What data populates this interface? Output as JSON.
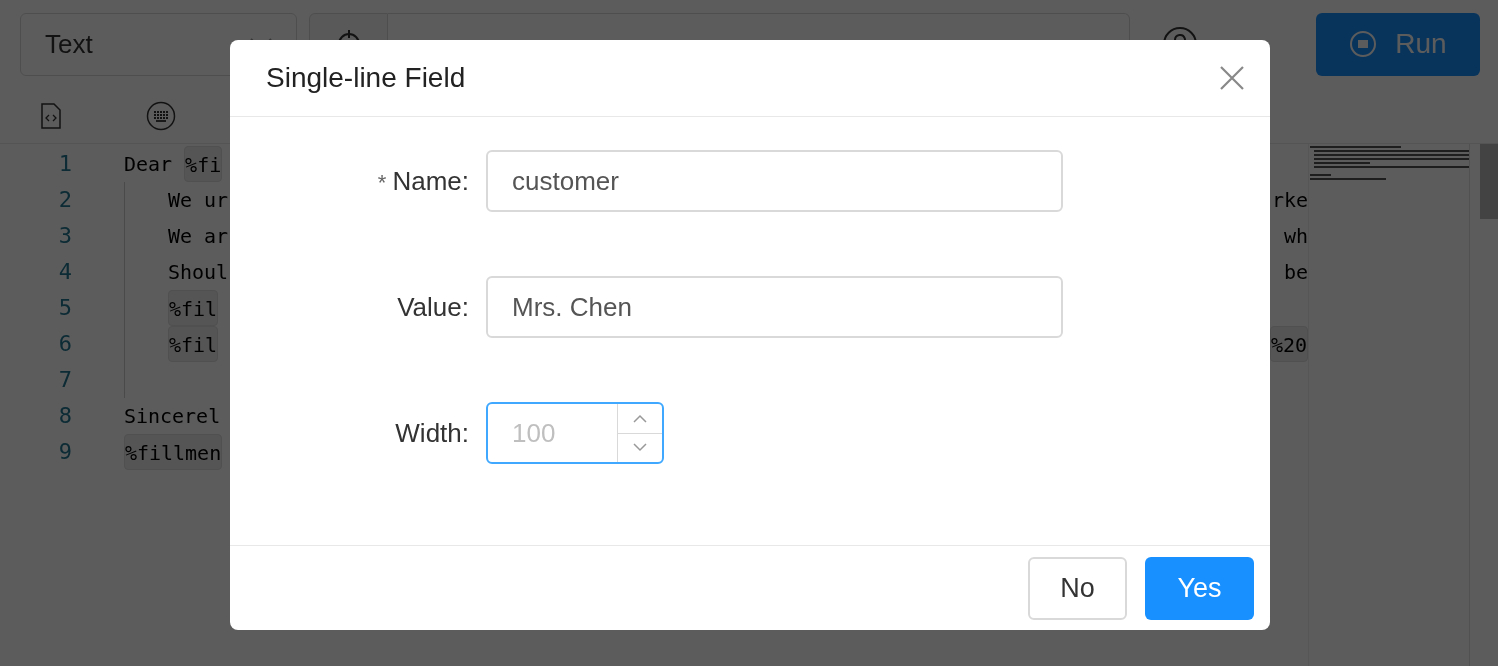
{
  "toolbar": {
    "mode_select": "Text",
    "run_button": "Run"
  },
  "editor": {
    "lines": [
      {
        "number": "1",
        "indented": false,
        "left": [
          {
            "kind": "plain",
            "text": "Dear "
          },
          {
            "kind": "chip",
            "text": "%fi"
          }
        ]
      },
      {
        "number": "2",
        "indented": true,
        "left": [
          {
            "kind": "plain",
            "text": "We ur"
          }
        ],
        "right": [
          {
            "kind": "plain",
            "text": "rke"
          }
        ]
      },
      {
        "number": "3",
        "indented": true,
        "left": [
          {
            "kind": "plain",
            "text": "We ar"
          }
        ],
        "right": [
          {
            "kind": "plain",
            "text": "wh"
          }
        ]
      },
      {
        "number": "4",
        "indented": true,
        "left": [
          {
            "kind": "plain",
            "text": "Shoul"
          }
        ],
        "right": [
          {
            "kind": "plain",
            "text": "be"
          }
        ]
      },
      {
        "number": "5",
        "indented": true,
        "left": [
          {
            "kind": "chip",
            "text": "%fil"
          }
        ]
      },
      {
        "number": "6",
        "indented": true,
        "left": [
          {
            "kind": "chip",
            "text": "%fil"
          }
        ],
        "right": [
          {
            "kind": "chip",
            "text": "%20"
          }
        ]
      },
      {
        "number": "7",
        "indented": true
      },
      {
        "number": "8",
        "indented": false,
        "left": [
          {
            "kind": "plain",
            "text": "Sincerel"
          }
        ]
      },
      {
        "number": "9",
        "indented": false,
        "left": [
          {
            "kind": "chip",
            "text": "%fillmen"
          }
        ]
      }
    ]
  },
  "dialog": {
    "title": "Single-line Field",
    "fields": [
      {
        "kind": "text",
        "label": "Name:",
        "required_mark": "*",
        "value": "customer",
        "focused": false
      },
      {
        "kind": "text",
        "label": "Value:",
        "value": "Mrs. Chen",
        "focused": false
      },
      {
        "kind": "number",
        "label": "Width:",
        "placeholder": "100",
        "focused": true
      }
    ],
    "buttons": [
      {
        "label": "No",
        "primary": false
      },
      {
        "label": "Yes",
        "primary": true
      }
    ]
  }
}
